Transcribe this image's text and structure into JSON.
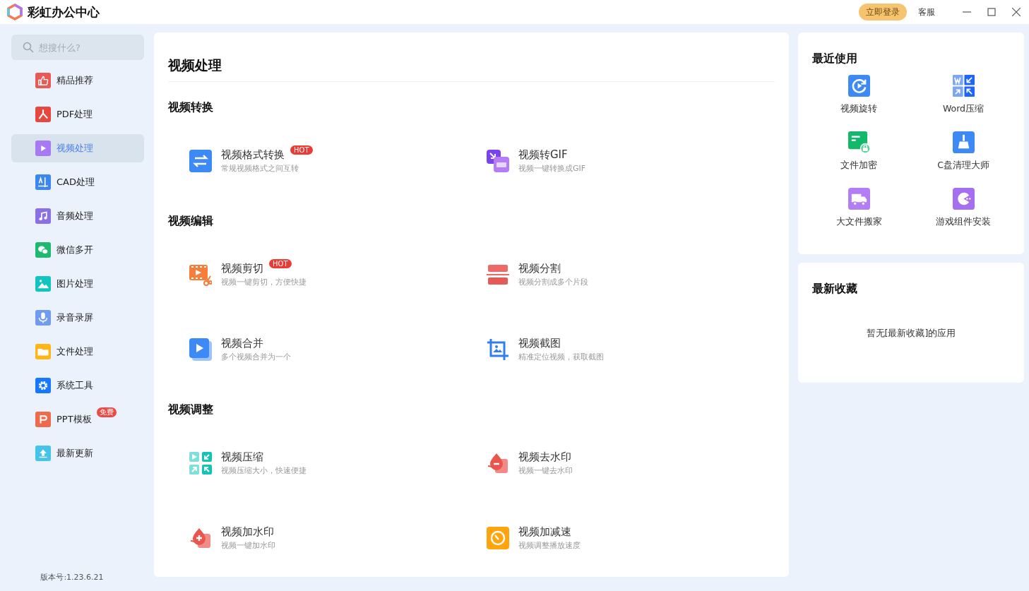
{
  "app": {
    "title": "彩虹办公中心"
  },
  "top_bar": {
    "login_button": "立即登录",
    "support_link": "客服"
  },
  "search": {
    "placeholder": "想搜什么?"
  },
  "sidebar": {
    "items": [
      {
        "label": "精品推荐",
        "kind": "thumb",
        "selected": false
      },
      {
        "label": "PDF处理",
        "kind": "pdf",
        "selected": false
      },
      {
        "label": "视频处理",
        "kind": "play",
        "selected": true
      },
      {
        "label": "CAD处理",
        "kind": "cad",
        "selected": false
      },
      {
        "label": "音频处理",
        "kind": "music",
        "selected": false
      },
      {
        "label": "微信多开",
        "kind": "chat",
        "selected": false
      },
      {
        "label": "图片处理",
        "kind": "image",
        "selected": false
      },
      {
        "label": "录音录屏",
        "kind": "mic",
        "selected": false
      },
      {
        "label": "文件处理",
        "kind": "folder",
        "selected": false
      },
      {
        "label": "系统工具",
        "kind": "gear",
        "selected": false
      },
      {
        "label": "PPT模板",
        "kind": "ppt",
        "selected": false,
        "badge": "免费"
      },
      {
        "label": "最新更新",
        "kind": "upload",
        "selected": false
      }
    ],
    "version": "版本号:1.23.6.21"
  },
  "main": {
    "title": "视频处理",
    "sections": [
      {
        "heading": "视频转换",
        "tools": [
          {
            "title": "视频格式转换",
            "description": "常规视频格式之间互转",
            "kind": "swap",
            "badge": "HOT"
          },
          {
            "title": "视频转GIF",
            "description": "视频一键转换成GIF",
            "kind": "gif"
          }
        ]
      },
      {
        "heading": "视频编辑",
        "tools": [
          {
            "title": "视频剪切",
            "description": "视频一键剪切，方便快捷",
            "kind": "cut",
            "badge": "HOT"
          },
          {
            "title": "视频分割",
            "description": "视频分割成多个片段",
            "kind": "split"
          },
          {
            "title": "视频合并",
            "description": "多个视频合并为一个",
            "kind": "merge"
          },
          {
            "title": "视频截图",
            "description": "精准定位视频，获取截图",
            "kind": "crop"
          }
        ]
      },
      {
        "heading": "视频调整",
        "tools": [
          {
            "title": "视频压缩",
            "description": "视频压缩大小，快速便捷",
            "kind": "compress"
          },
          {
            "title": "视频去水印",
            "description": "视频一键去水印",
            "kind": "unmark"
          },
          {
            "title": "视频加水印",
            "description": "视频一键加水印",
            "kind": "mark"
          },
          {
            "title": "视频加减速",
            "description": "视频调整播放速度",
            "kind": "speed"
          }
        ]
      }
    ]
  },
  "recent": {
    "heading": "最近使用",
    "apps": [
      {
        "label": "视频旋转",
        "kind": "rotate"
      },
      {
        "label": "Word压缩",
        "kind": "wordzip"
      },
      {
        "label": "文件加密",
        "kind": "lock"
      },
      {
        "label": "C盘清理大师",
        "kind": "broom"
      },
      {
        "label": "大文件搬家",
        "kind": "truck"
      },
      {
        "label": "游戏组件安装",
        "kind": "game"
      }
    ]
  },
  "favorites": {
    "heading": "最新收藏",
    "empty_text": "暂无[最新收藏]的应用"
  }
}
